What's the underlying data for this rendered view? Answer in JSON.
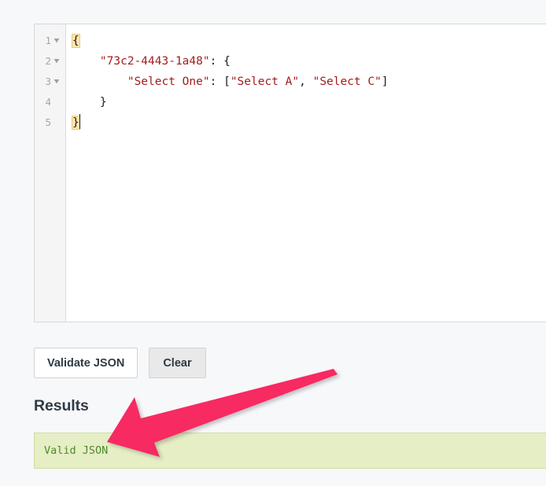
{
  "editor": {
    "language": "json",
    "lines": [
      {
        "number": "1",
        "foldable": true,
        "fold_icon": "chevron-down-icon",
        "tokens": [
          {
            "text": "{",
            "type": "brace-match"
          }
        ]
      },
      {
        "number": "2",
        "foldable": true,
        "fold_icon": "chevron-down-icon",
        "tokens": [
          {
            "text": "    ",
            "type": "plain"
          },
          {
            "text": "\"73c2-4443-1a48\"",
            "type": "string"
          },
          {
            "text": ": {",
            "type": "punct"
          }
        ]
      },
      {
        "number": "3",
        "foldable": true,
        "fold_icon": "chevron-down-icon",
        "tokens": [
          {
            "text": "        ",
            "type": "plain"
          },
          {
            "text": "\"Select One\"",
            "type": "string"
          },
          {
            "text": ": [",
            "type": "punct"
          },
          {
            "text": "\"Select A\"",
            "type": "string"
          },
          {
            "text": ", ",
            "type": "punct"
          },
          {
            "text": "\"Select C\"",
            "type": "string"
          },
          {
            "text": "]",
            "type": "punct"
          }
        ]
      },
      {
        "number": "4",
        "foldable": false,
        "fold_icon": "",
        "tokens": [
          {
            "text": "    }",
            "type": "punct"
          }
        ]
      },
      {
        "number": "5",
        "foldable": false,
        "fold_icon": "",
        "tokens": [
          {
            "text": "}",
            "type": "brace-match"
          },
          {
            "text": "",
            "type": "caret"
          }
        ]
      }
    ],
    "raw_text": "{\n    \"73c2-4443-1a48\": {\n        \"Select One\": [\"Select A\", \"Select C\"]\n    }\n}",
    "cursor": {
      "line": "5",
      "column": "2"
    }
  },
  "toolbar": {
    "validate_label": "Validate JSON",
    "clear_label": "Clear"
  },
  "results": {
    "heading": "Results",
    "message": "Valid JSON",
    "status": "valid"
  },
  "annotation": {
    "arrow_icon": "arrow-pointer-icon",
    "color": "#f72a62",
    "points_at": "Valid JSON"
  },
  "colors": {
    "page_background": "#f7f8fa",
    "editor_background": "#ffffff",
    "gutter_background": "#f5f5f5",
    "string_token": "#a31d1d",
    "result_background": "#e5eec4",
    "result_border": "#cfdca0",
    "result_text": "#4f8a2e",
    "annotation_arrow": "#f72a62"
  }
}
